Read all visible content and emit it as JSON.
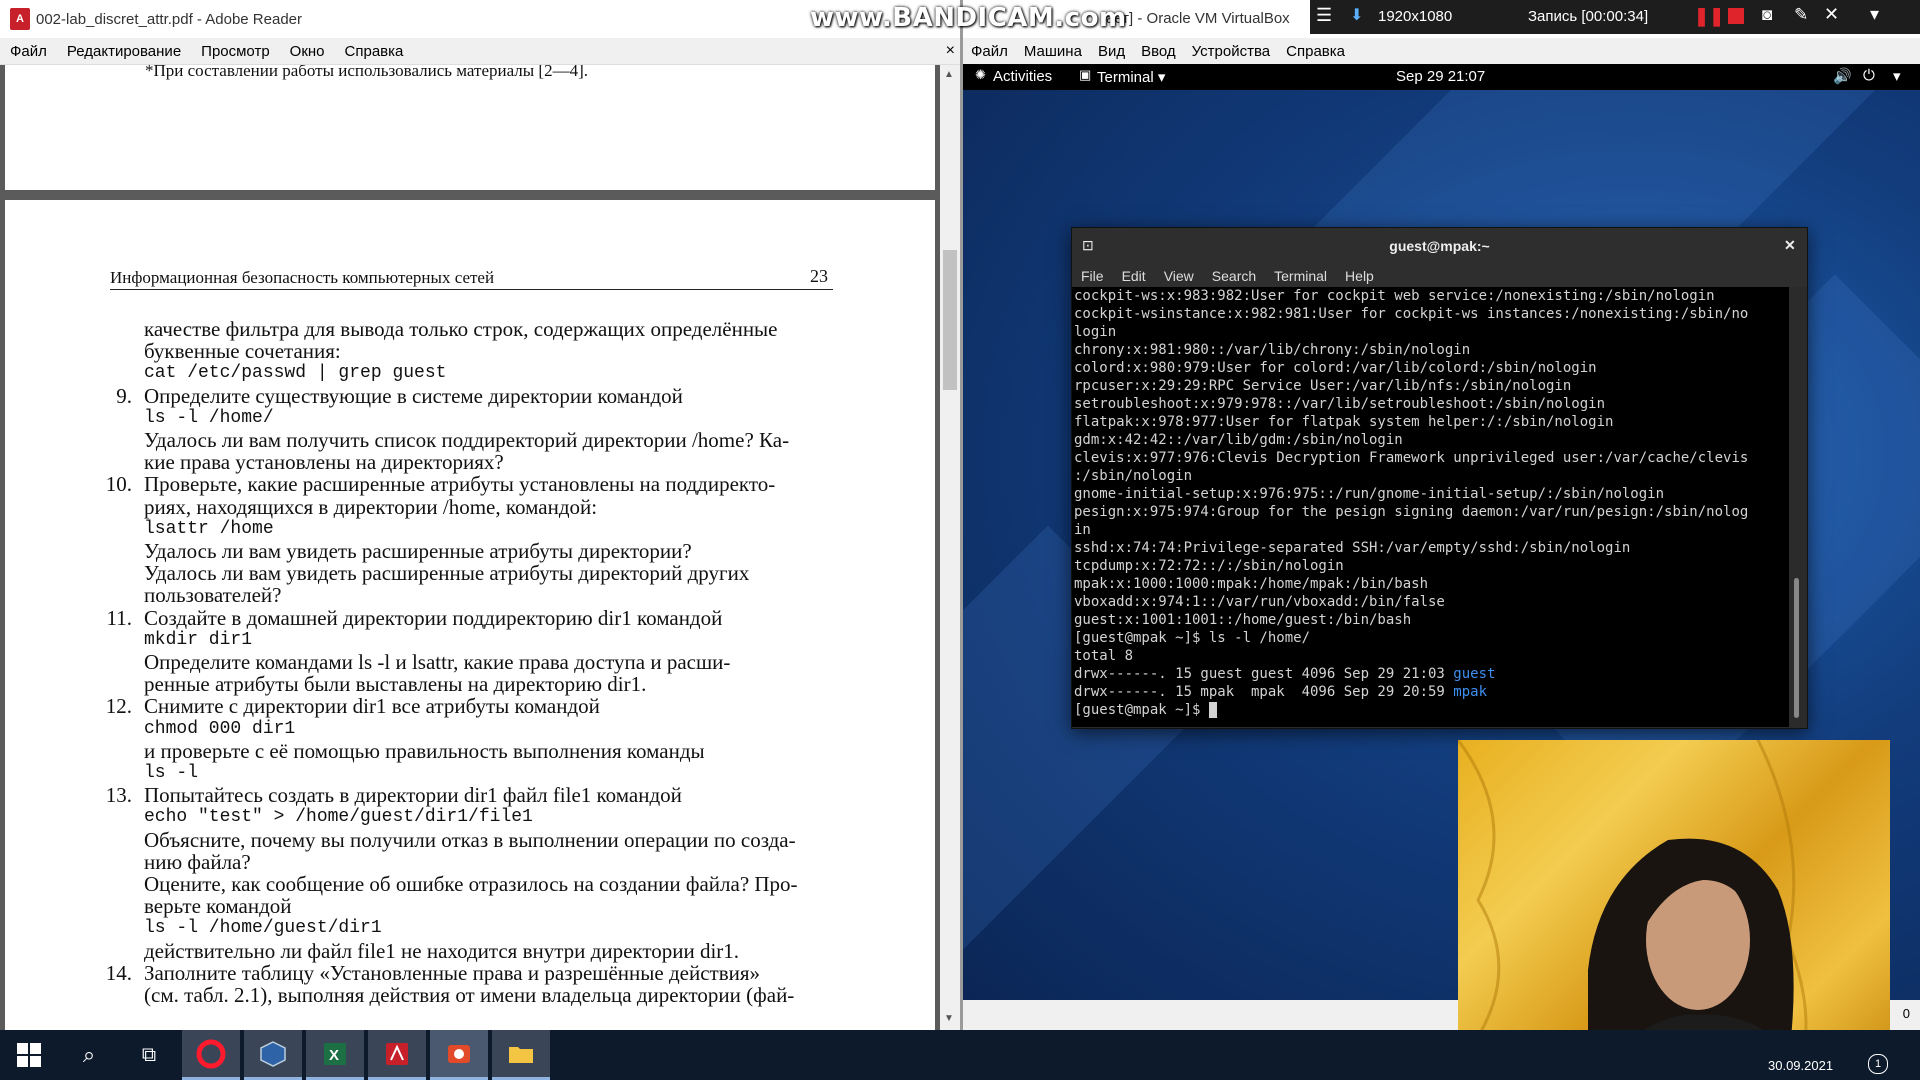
{
  "reader": {
    "title": "002-lab_discret_attr.pdf - Adobe Reader",
    "pdf_icon_text": "A",
    "menu": [
      "Файл",
      "Редактирование",
      "Просмотр",
      "Окно",
      "Справка"
    ],
    "close": "×",
    "prev_page_footnote": "*При составлении работы использовались материалы [2—4].",
    "header_left": "Информационная безопасность компьютерных сетей",
    "header_page": "23",
    "lines": [
      {
        "num": "",
        "text": "качестве фильтра для вывода только строк, содержащих определённые",
        "mono": false
      },
      {
        "num": "",
        "text": "буквенные сочетания:",
        "mono": false
      },
      {
        "num": "",
        "text": "cat /etc/passwd | grep guest",
        "mono": true
      },
      {
        "num": "9.",
        "text": "Определите существующие в системе директории командой",
        "mono": false
      },
      {
        "num": "",
        "text": "ls -l /home/",
        "mono": true
      },
      {
        "num": "",
        "text": "Удалось ли вам получить список поддиректорий директории /home? Ка-",
        "mono": false
      },
      {
        "num": "",
        "text": "кие права установлены на директориях?",
        "mono": false
      },
      {
        "num": "10.",
        "text": "Проверьте, какие расширенные атрибуты установлены на поддиректо-",
        "mono": false
      },
      {
        "num": "",
        "text": "риях, находящихся в директории /home, командой:",
        "mono": false
      },
      {
        "num": "",
        "text": "lsattr /home",
        "mono": true
      },
      {
        "num": "",
        "text": "Удалось ли вам увидеть расширенные атрибуты директории?",
        "mono": false
      },
      {
        "num": "",
        "text": "Удалось ли вам увидеть расширенные атрибуты директорий других",
        "mono": false
      },
      {
        "num": "",
        "text": "пользователей?",
        "mono": false
      },
      {
        "num": "11.",
        "text": "Создайте в домашней директории поддиректорию dir1 командой",
        "mono": false
      },
      {
        "num": "",
        "text": "mkdir dir1",
        "mono": true
      },
      {
        "num": "",
        "text": "Определите командами ls -l и lsattr, какие права доступа и расши-",
        "mono": false
      },
      {
        "num": "",
        "text": "ренные атрибуты были выставлены на директорию dir1.",
        "mono": false
      },
      {
        "num": "12.",
        "text": "Снимите с директории dir1 все атрибуты командой",
        "mono": false
      },
      {
        "num": "",
        "text": "chmod 000 dir1",
        "mono": true
      },
      {
        "num": "",
        "text": "и проверьте с её помощью правильность выполнения команды",
        "mono": false
      },
      {
        "num": "",
        "text": "ls -l",
        "mono": true
      },
      {
        "num": "13.",
        "text": "Попытайтесь создать в директории dir1 файл file1 командой",
        "mono": false
      },
      {
        "num": "",
        "text": "echo \"test\" > /home/guest/dir1/file1",
        "mono": true
      },
      {
        "num": "",
        "text": "Объясните, почему вы получили отказ в выполнении операции по созда-",
        "mono": false
      },
      {
        "num": "",
        "text": "нию файла?",
        "mono": false
      },
      {
        "num": "",
        "text": "Оцените, как сообщение об ошибке отразилось на создании файла? Про-",
        "mono": false
      },
      {
        "num": "",
        "text": "верьте командой",
        "mono": false
      },
      {
        "num": "",
        "text": "ls -l /home/guest/dir1",
        "mono": true
      },
      {
        "num": "",
        "text": "действительно ли файл file1 не находится внутри директории dir1.",
        "mono": false
      },
      {
        "num": "14.",
        "text": "Заполните таблицу «Установленные права и разрешённые действия»",
        "mono": false
      },
      {
        "num": "",
        "text": "(см. табл. 2.1), выполняя действия от имени владельца директории (фай-",
        "mono": false
      }
    ]
  },
  "vm": {
    "title": "[Работает] - Oracle VM VirtualBox",
    "title_visible": "ает] - Oracle VM VirtualBox",
    "menu": [
      "Файл",
      "Машина",
      "Вид",
      "Ввод",
      "Устройства",
      "Справка"
    ],
    "gnome": {
      "activities": "Activities",
      "app": "Terminal",
      "clock": "Sep 29  21:07"
    }
  },
  "bandicam": {
    "watermark": "www.BANDICAM.com",
    "resolution": "1920x1080",
    "record_label": "Запись [00:00:34]"
  },
  "terminal": {
    "title": "guest@mpak:~",
    "menu": [
      "File",
      "Edit",
      "View",
      "Search",
      "Terminal",
      "Help"
    ],
    "lines": [
      "cockpit-ws:x:983:982:User for cockpit web service:/nonexisting:/sbin/nologin",
      "cockpit-wsinstance:x:982:981:User for cockpit-ws instances:/nonexisting:/sbin/no",
      "login",
      "chrony:x:981:980::/var/lib/chrony:/sbin/nologin",
      "colord:x:980:979:User for colord:/var/lib/colord:/sbin/nologin",
      "rpcuser:x:29:29:RPC Service User:/var/lib/nfs:/sbin/nologin",
      "setroubleshoot:x:979:978::/var/lib/setroubleshoot:/sbin/nologin",
      "flatpak:x:978:977:User for flatpak system helper:/:/sbin/nologin",
      "gdm:x:42:42::/var/lib/gdm:/sbin/nologin",
      "clevis:x:977:976:Clevis Decryption Framework unprivileged user:/var/cache/clevis",
      ":/sbin/nologin",
      "gnome-initial-setup:x:976:975::/run/gnome-initial-setup/:/sbin/nologin",
      "pesign:x:975:974:Group for the pesign signing daemon:/var/run/pesign:/sbin/nolog",
      "in",
      "sshd:x:74:74:Privilege-separated SSH:/var/empty/sshd:/sbin/nologin",
      "tcpdump:x:72:72::/:/sbin/nologin",
      "mpak:x:1000:1000:mpak:/home/mpak:/bin/bash",
      "vboxadd:x:974:1::/var/run/vboxadd:/bin/false",
      "guest:x:1001:1001::/home/guest:/bin/bash",
      "[guest@mpak ~]$ ls -l /home/",
      "total 8"
    ],
    "ls_rows": [
      {
        "prefix": "drwx------. 15 guest guest 4096 Sep 29 21:03 ",
        "name": "guest"
      },
      {
        "prefix": "drwx------. 15 mpak  mpak  4096 Sep 29 20:59 ",
        "name": "mpak"
      }
    ],
    "prompt": "[guest@mpak ~]$ "
  },
  "taskbar": {
    "date": "30.09.2021",
    "notification_count": "1",
    "vm_corner": "0"
  },
  "colors": {
    "terminal_dir": "#3d8ff0",
    "bandicam_record": "#e0242c"
  }
}
